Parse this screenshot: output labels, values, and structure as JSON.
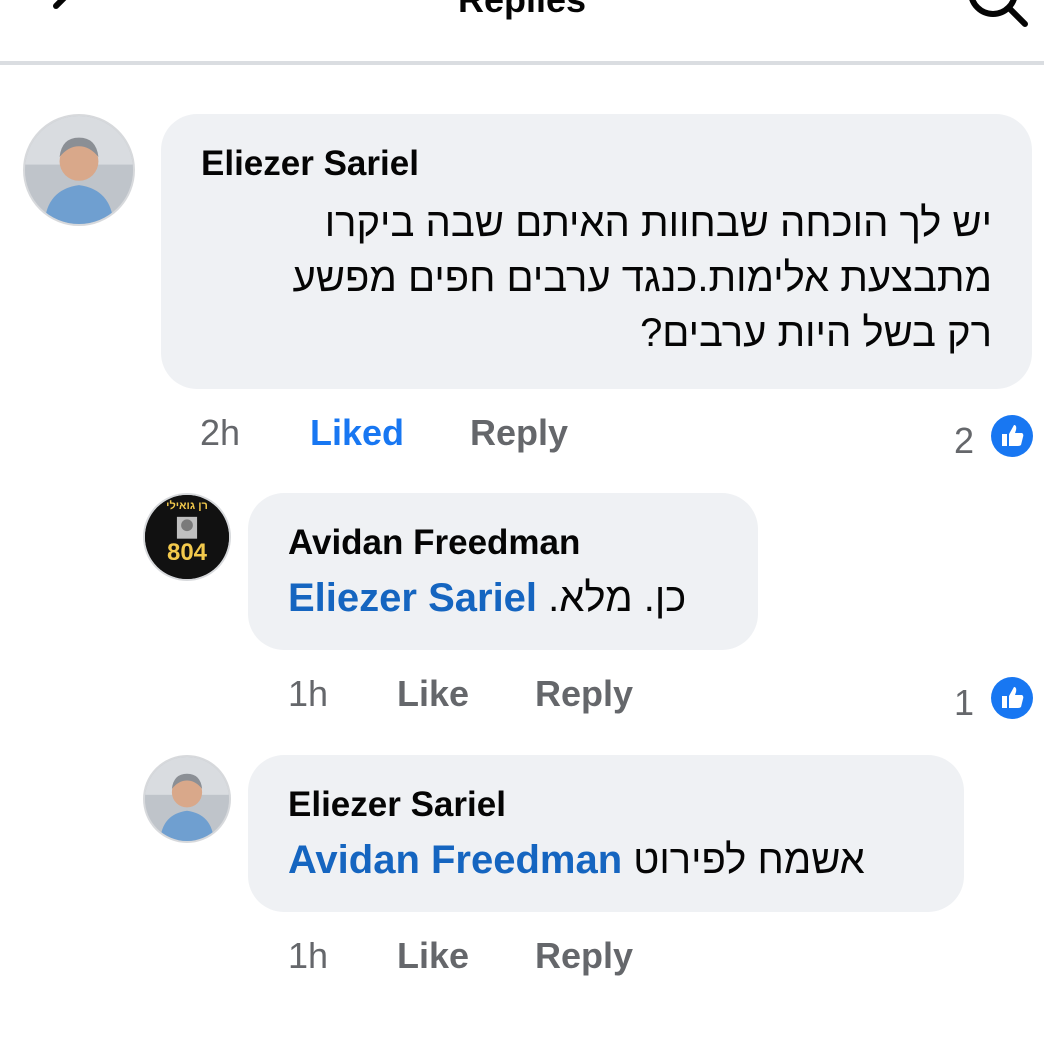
{
  "header": {
    "title": "Replies",
    "back_icon": "back-arrow-icon",
    "search_icon": "search-icon"
  },
  "comments": [
    {
      "author": "Eliezer Sariel",
      "lines": [
        "יש לך הוכחה שבחוות האיתם שבה ביקרו",
        "מתבצעת אלימות.כנגד ערבים חפים מפשע",
        "רק בשל היות ערבים?"
      ],
      "time": "2h",
      "like_label": "Liked",
      "reply_label": "Reply",
      "reaction_count": "2"
    },
    {
      "author": "Avidan Freedman",
      "mention": "Eliezer Sariel",
      "text": "כן. מלא.",
      "avatar_text_top": "רן גואילי",
      "avatar_text_number": "804",
      "time": "1h",
      "like_label": "Like",
      "reply_label": "Reply",
      "reaction_count": "1"
    },
    {
      "author": "Eliezer Sariel",
      "mention": "Avidan Freedman",
      "text": "אשמח לפירוט",
      "time": "1h",
      "like_label": "Like",
      "reply_label": "Reply"
    }
  ],
  "colors": {
    "liked": "#1877f2",
    "mention": "#1565c0",
    "bubble": "#eff1f4",
    "secondary_text": "#65676b",
    "avatar_badge_number": "#f2c94c"
  }
}
